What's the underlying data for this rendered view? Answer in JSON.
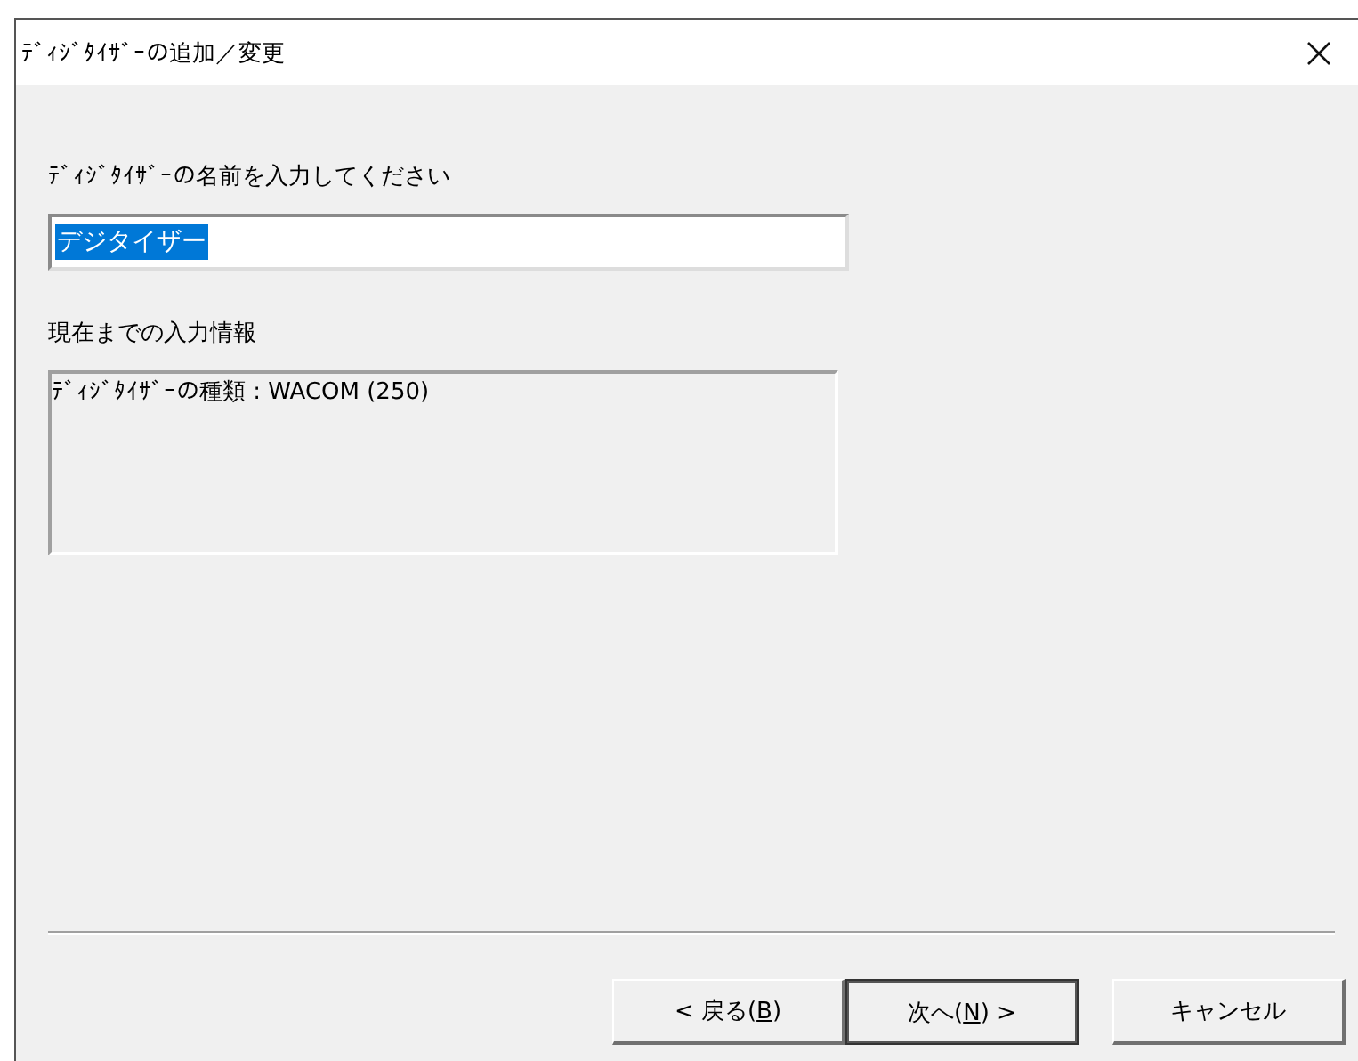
{
  "window": {
    "title": "ﾃﾞｨｼﾞﾀｲｻﾞｰの追加／変更"
  },
  "name_label": "ﾃﾞｨｼﾞﾀｲｻﾞｰの名前を入力してください",
  "name_field": {
    "value": "デジタイザー",
    "text_selected": true
  },
  "info_label": "現在までの入力情報",
  "info_box": {
    "lines": [
      "ﾃﾞｨｼﾞﾀｲｻﾞｰの種類 : WACOM (250)"
    ]
  },
  "buttons": [
    {
      "before": "< 戻る(",
      "key": "B",
      "after": ")",
      "default": false
    },
    {
      "before": "次へ(",
      "key": "N",
      "after": ") >",
      "default": true
    },
    {
      "before": "キャンセル",
      "default": false
    }
  ]
}
